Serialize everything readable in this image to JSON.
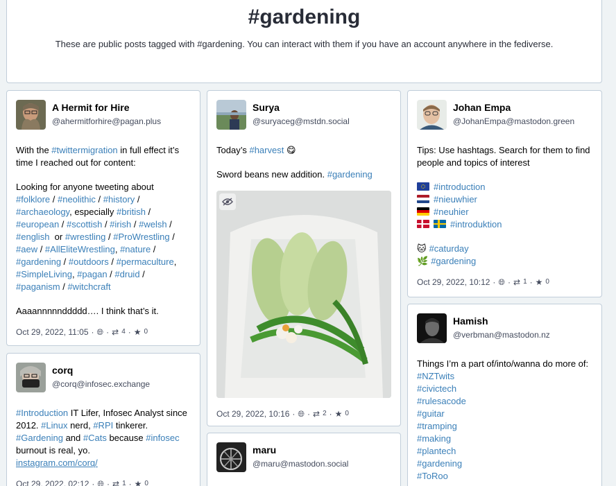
{
  "header": {
    "title": "#gardening",
    "subtitle": "These are public posts tagged with #gardening. You can interact with them if you have an account anywhere in the fediverse."
  },
  "posts": [
    {
      "display_name": "A Hermit for Hire",
      "acct": "@ahermitforhire@pagan.plus",
      "p1_a": "With the ",
      "p1_tag": "#twittermigration",
      "p1_b": " in full effect it’s time I reached out for content:",
      "p2_lead": "Looking for anyone tweeting about",
      "tags": [
        "#folklore",
        "#neolithic",
        "#history",
        "#archaeology",
        "#british",
        "#european",
        "#scottish",
        "#irish",
        "#welsh",
        "#english",
        "#wrestling",
        "#ProWrestling",
        "#aew",
        "#AllEliteWrestling",
        "#nature",
        "#gardening",
        "#outdoors",
        "#permaculture",
        "#SimpleLiving",
        "#pagan",
        "#druid",
        "#paganism",
        "#witchcraft"
      ],
      "especially": ", especially ",
      "or": "  or ",
      "p3": "Aaaannnnnddddd…. I think that’s it.",
      "date": "Oct 29, 2022, 11:05",
      "boosts": "4",
      "favs": "0"
    },
    {
      "display_name": "corq",
      "acct": "@corq@infosec.exchange",
      "tag1": "#Introduction",
      "t1": " IT Lifer, Infosec Analyst since 2012. ",
      "tag2": "#Linux",
      "t2": " nerd, ",
      "tag3": "#RPI",
      "t3": " tinkerer.",
      "tag4": "#Gardening",
      "t4": " and ",
      "tag5": "#Cats",
      "t5": " because ",
      "tag6": "#infosec",
      "t6": "burnout is real, yo.",
      "link": "instagram.com/corq/",
      "date": "Oct 29, 2022, 02:12",
      "boosts": "1",
      "favs": "0"
    },
    {
      "display_name": "Surya",
      "acct": "@suryaceg@mstdn.social",
      "p1_a": "Today’s ",
      "p1_tag": "#harvest",
      "emoji": "😋",
      "p2_a": "Sword beans new addition. ",
      "p2_tag": "#gardening",
      "date": "Oct 29, 2022, 10:16",
      "boosts": "2",
      "favs": "0"
    },
    {
      "display_name": "maru",
      "acct": "@maru@mastodon.social"
    },
    {
      "display_name": "Johan Empa",
      "acct": "@JohanEmpa@mastodon.green",
      "p1": "Tips: Use hashtags. Search for them to find people and topics of interest",
      "tags": [
        "#introduction",
        "#nieuwhier",
        "#neuhier",
        "#introduktion",
        "#caturday",
        "#gardening"
      ],
      "date": "Oct 29, 2022, 10:12",
      "boosts": "1",
      "favs": "0"
    },
    {
      "display_name": "Hamish",
      "acct": "@verbman@mastodon.nz",
      "p1": "Things I’m a part of/into/wanna do more of:",
      "tags": [
        "#NZTwits",
        "#civictech",
        "#rulesacode",
        "#guitar",
        "#tramping",
        "#making",
        "#plantech",
        "#gardening",
        "#ToRoo"
      ]
    }
  ],
  "sep": " · ",
  "slash": " / "
}
